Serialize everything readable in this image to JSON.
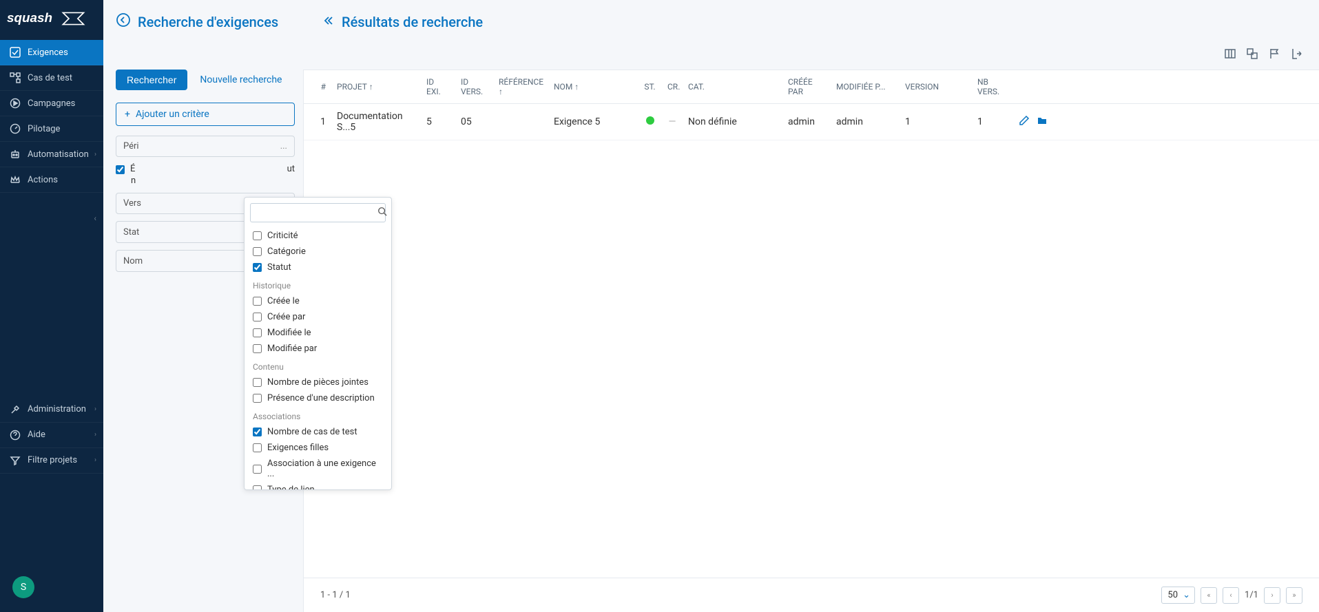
{
  "sidebar": {
    "items": [
      {
        "label": "Exigences"
      },
      {
        "label": "Cas de test"
      },
      {
        "label": "Campagnes"
      },
      {
        "label": "Pilotage"
      },
      {
        "label": "Automatisation"
      },
      {
        "label": "Actions"
      }
    ],
    "bottom": [
      {
        "label": "Administration"
      },
      {
        "label": "Aide"
      },
      {
        "label": "Filtre projets"
      }
    ],
    "avatar": "S"
  },
  "header": {
    "left_title": "Recherche d'exigences",
    "right_title": "Résultats de recherche"
  },
  "search": {
    "btn_search": "Rechercher",
    "btn_new": "Nouvelle recherche",
    "add_criteria": "Ajouter un critère",
    "field_peri_prefix": "Péri",
    "field_peri_dots": "...",
    "checkbox_suffix": "ut",
    "checkbox_label_prefix": "É",
    "checkbox_line2": "n",
    "field_vers": "Vers",
    "field_stat": "Stat",
    "field_nom": "Nom"
  },
  "dropdown": {
    "options": [
      {
        "label": "Criticité",
        "checked": false
      },
      {
        "label": "Catégorie",
        "checked": false
      },
      {
        "label": "Statut",
        "checked": true
      }
    ],
    "group_hist": "Historique",
    "hist_items": [
      {
        "label": "Créée le",
        "checked": false
      },
      {
        "label": "Créée par",
        "checked": false
      },
      {
        "label": "Modifiée le",
        "checked": false
      },
      {
        "label": "Modifiée par",
        "checked": false
      }
    ],
    "group_cont": "Contenu",
    "cont_items": [
      {
        "label": "Nombre de pièces jointes",
        "checked": false
      },
      {
        "label": "Présence d'une description",
        "checked": false
      }
    ],
    "group_assoc": "Associations",
    "assoc_items": [
      {
        "label": "Nombre de cas de test",
        "checked": true
      },
      {
        "label": "Exigences filles",
        "checked": false
      },
      {
        "label": "Association à une exigence ...",
        "checked": false
      },
      {
        "label": "Type de lien",
        "checked": false
      }
    ]
  },
  "table": {
    "headers": {
      "num": "#",
      "projet": "PROJET",
      "idexi": "ID EXI.",
      "idvers": "ID VERS.",
      "reference": "RÉFÉRENCE",
      "nom": "NOM",
      "st": "ST.",
      "cr": "CR.",
      "cat": "CAT.",
      "creee": "CRÉÉE PAR",
      "modifiee": "MODIFIÉE P...",
      "version": "VERSION",
      "nbvers": "NB VERS."
    },
    "rows": [
      {
        "num": "1",
        "projet": "Documentation S...5",
        "idexi": "5",
        "idvers": "05",
        "reference": "",
        "nom": "Exigence 5",
        "cr": "—",
        "cat": "Non définie",
        "creee": "admin",
        "modifiee": "admin",
        "version": "1",
        "nbvers": "1"
      }
    ]
  },
  "footer": {
    "range": "1 - 1 / 1",
    "page_size": "50",
    "page_info": "1/1"
  }
}
